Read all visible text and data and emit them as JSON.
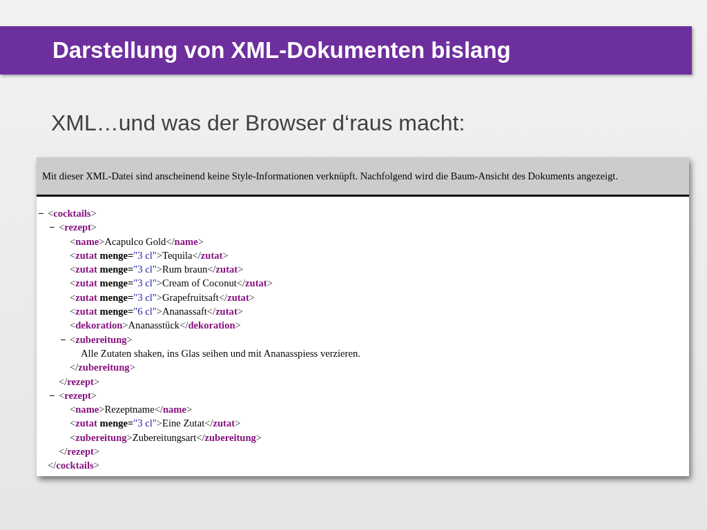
{
  "slide": {
    "title": "Darstellung von XML-Dokumenten bislang",
    "subtitle": "XML…und was der Browser d‘raus macht:"
  },
  "browser": {
    "notice": "Mit dieser XML-Datei sind anscheinend keine Style-Informationen verknüpft. Nachfolgend wird die Baum-Ansicht des Dokuments angezeigt.",
    "tree": [
      {
        "toggle": "−",
        "open": [
          {
            "kind": "punct",
            "text": "<"
          },
          {
            "kind": "tag",
            "text": "cocktails"
          },
          {
            "kind": "punct",
            "text": ">"
          }
        ],
        "close": [
          {
            "kind": "punct",
            "text": "</"
          },
          {
            "kind": "tag",
            "text": "cocktails"
          },
          {
            "kind": "punct",
            "text": ">"
          }
        ],
        "children": [
          {
            "toggle": "−",
            "open": [
              {
                "kind": "punct",
                "text": "<"
              },
              {
                "kind": "tag",
                "text": "rezept"
              },
              {
                "kind": "punct",
                "text": ">"
              }
            ],
            "close": [
              {
                "kind": "punct",
                "text": "</"
              },
              {
                "kind": "tag",
                "text": "rezept"
              },
              {
                "kind": "punct",
                "text": ">"
              }
            ],
            "children": [
              {
                "line": [
                  {
                    "kind": "punct",
                    "text": "<"
                  },
                  {
                    "kind": "tag",
                    "text": "name"
                  },
                  {
                    "kind": "punct",
                    "text": ">"
                  },
                  {
                    "kind": "text",
                    "text": "Acapulco Gold"
                  },
                  {
                    "kind": "punct",
                    "text": "</"
                  },
                  {
                    "kind": "tag",
                    "text": "name"
                  },
                  {
                    "kind": "punct",
                    "text": ">"
                  }
                ]
              },
              {
                "line": [
                  {
                    "kind": "punct",
                    "text": "<"
                  },
                  {
                    "kind": "tag",
                    "text": "zutat"
                  },
                  {
                    "kind": "attr",
                    "text": " menge="
                  },
                  {
                    "kind": "value",
                    "text": "\"3 cl\""
                  },
                  {
                    "kind": "punct",
                    "text": ">"
                  },
                  {
                    "kind": "text",
                    "text": "Tequila"
                  },
                  {
                    "kind": "punct",
                    "text": "</"
                  },
                  {
                    "kind": "tag",
                    "text": "zutat"
                  },
                  {
                    "kind": "punct",
                    "text": ">"
                  }
                ]
              },
              {
                "line": [
                  {
                    "kind": "punct",
                    "text": "<"
                  },
                  {
                    "kind": "tag",
                    "text": "zutat"
                  },
                  {
                    "kind": "attr",
                    "text": " menge="
                  },
                  {
                    "kind": "value",
                    "text": "\"3 cl\""
                  },
                  {
                    "kind": "punct",
                    "text": ">"
                  },
                  {
                    "kind": "text",
                    "text": "Rum braun"
                  },
                  {
                    "kind": "punct",
                    "text": "</"
                  },
                  {
                    "kind": "tag",
                    "text": "zutat"
                  },
                  {
                    "kind": "punct",
                    "text": ">"
                  }
                ]
              },
              {
                "line": [
                  {
                    "kind": "punct",
                    "text": "<"
                  },
                  {
                    "kind": "tag",
                    "text": "zutat"
                  },
                  {
                    "kind": "attr",
                    "text": " menge="
                  },
                  {
                    "kind": "value",
                    "text": "\"3 cl\""
                  },
                  {
                    "kind": "punct",
                    "text": ">"
                  },
                  {
                    "kind": "text",
                    "text": "Cream of Coconut"
                  },
                  {
                    "kind": "punct",
                    "text": "</"
                  },
                  {
                    "kind": "tag",
                    "text": "zutat"
                  },
                  {
                    "kind": "punct",
                    "text": ">"
                  }
                ]
              },
              {
                "line": [
                  {
                    "kind": "punct",
                    "text": "<"
                  },
                  {
                    "kind": "tag",
                    "text": "zutat"
                  },
                  {
                    "kind": "attr",
                    "text": " menge="
                  },
                  {
                    "kind": "value",
                    "text": "\"3 cl\""
                  },
                  {
                    "kind": "punct",
                    "text": ">"
                  },
                  {
                    "kind": "text",
                    "text": "Grapefruitsaft"
                  },
                  {
                    "kind": "punct",
                    "text": "</"
                  },
                  {
                    "kind": "tag",
                    "text": "zutat"
                  },
                  {
                    "kind": "punct",
                    "text": ">"
                  }
                ]
              },
              {
                "line": [
                  {
                    "kind": "punct",
                    "text": "<"
                  },
                  {
                    "kind": "tag",
                    "text": "zutat"
                  },
                  {
                    "kind": "attr",
                    "text": " menge="
                  },
                  {
                    "kind": "value",
                    "text": "\"6 cl\""
                  },
                  {
                    "kind": "punct",
                    "text": ">"
                  },
                  {
                    "kind": "text",
                    "text": "Ananassaft"
                  },
                  {
                    "kind": "punct",
                    "text": "</"
                  },
                  {
                    "kind": "tag",
                    "text": "zutat"
                  },
                  {
                    "kind": "punct",
                    "text": ">"
                  }
                ]
              },
              {
                "line": [
                  {
                    "kind": "punct",
                    "text": "<"
                  },
                  {
                    "kind": "tag",
                    "text": "dekoration"
                  },
                  {
                    "kind": "punct",
                    "text": ">"
                  },
                  {
                    "kind": "text",
                    "text": "Ananasstück"
                  },
                  {
                    "kind": "punct",
                    "text": "</"
                  },
                  {
                    "kind": "tag",
                    "text": "dekoration"
                  },
                  {
                    "kind": "punct",
                    "text": ">"
                  }
                ]
              },
              {
                "toggle": "−",
                "open": [
                  {
                    "kind": "punct",
                    "text": "<"
                  },
                  {
                    "kind": "tag",
                    "text": "zubereitung"
                  },
                  {
                    "kind": "punct",
                    "text": ">"
                  }
                ],
                "close": [
                  {
                    "kind": "punct",
                    "text": "</"
                  },
                  {
                    "kind": "tag",
                    "text": "zubereitung"
                  },
                  {
                    "kind": "punct",
                    "text": ">"
                  }
                ],
                "children": [
                  {
                    "line": [
                      {
                        "kind": "text",
                        "text": "Alle Zutaten shaken, ins Glas seihen und mit Ananasspiess verzieren."
                      }
                    ]
                  }
                ]
              }
            ]
          },
          {
            "toggle": "−",
            "open": [
              {
                "kind": "punct",
                "text": "<"
              },
              {
                "kind": "tag",
                "text": "rezept"
              },
              {
                "kind": "punct",
                "text": ">"
              }
            ],
            "close": [
              {
                "kind": "punct",
                "text": "</"
              },
              {
                "kind": "tag",
                "text": "rezept"
              },
              {
                "kind": "punct",
                "text": ">"
              }
            ],
            "children": [
              {
                "line": [
                  {
                    "kind": "punct",
                    "text": "<"
                  },
                  {
                    "kind": "tag",
                    "text": "name"
                  },
                  {
                    "kind": "punct",
                    "text": ">"
                  },
                  {
                    "kind": "text",
                    "text": "Rezeptname"
                  },
                  {
                    "kind": "punct",
                    "text": "</"
                  },
                  {
                    "kind": "tag",
                    "text": "name"
                  },
                  {
                    "kind": "punct",
                    "text": ">"
                  }
                ]
              },
              {
                "line": [
                  {
                    "kind": "punct",
                    "text": "<"
                  },
                  {
                    "kind": "tag",
                    "text": "zutat"
                  },
                  {
                    "kind": "attr",
                    "text": " menge="
                  },
                  {
                    "kind": "value",
                    "text": "\"3 cl\""
                  },
                  {
                    "kind": "punct",
                    "text": ">"
                  },
                  {
                    "kind": "text",
                    "text": "Eine Zutat"
                  },
                  {
                    "kind": "punct",
                    "text": "</"
                  },
                  {
                    "kind": "tag",
                    "text": "zutat"
                  },
                  {
                    "kind": "punct",
                    "text": ">"
                  }
                ]
              },
              {
                "line": [
                  {
                    "kind": "punct",
                    "text": "<"
                  },
                  {
                    "kind": "tag",
                    "text": "zubereitung"
                  },
                  {
                    "kind": "punct",
                    "text": ">"
                  },
                  {
                    "kind": "text",
                    "text": "Zubereitungsart"
                  },
                  {
                    "kind": "punct",
                    "text": "</"
                  },
                  {
                    "kind": "tag",
                    "text": "zubereitung"
                  },
                  {
                    "kind": "punct",
                    "text": ">"
                  }
                ]
              }
            ]
          }
        ]
      }
    ]
  }
}
